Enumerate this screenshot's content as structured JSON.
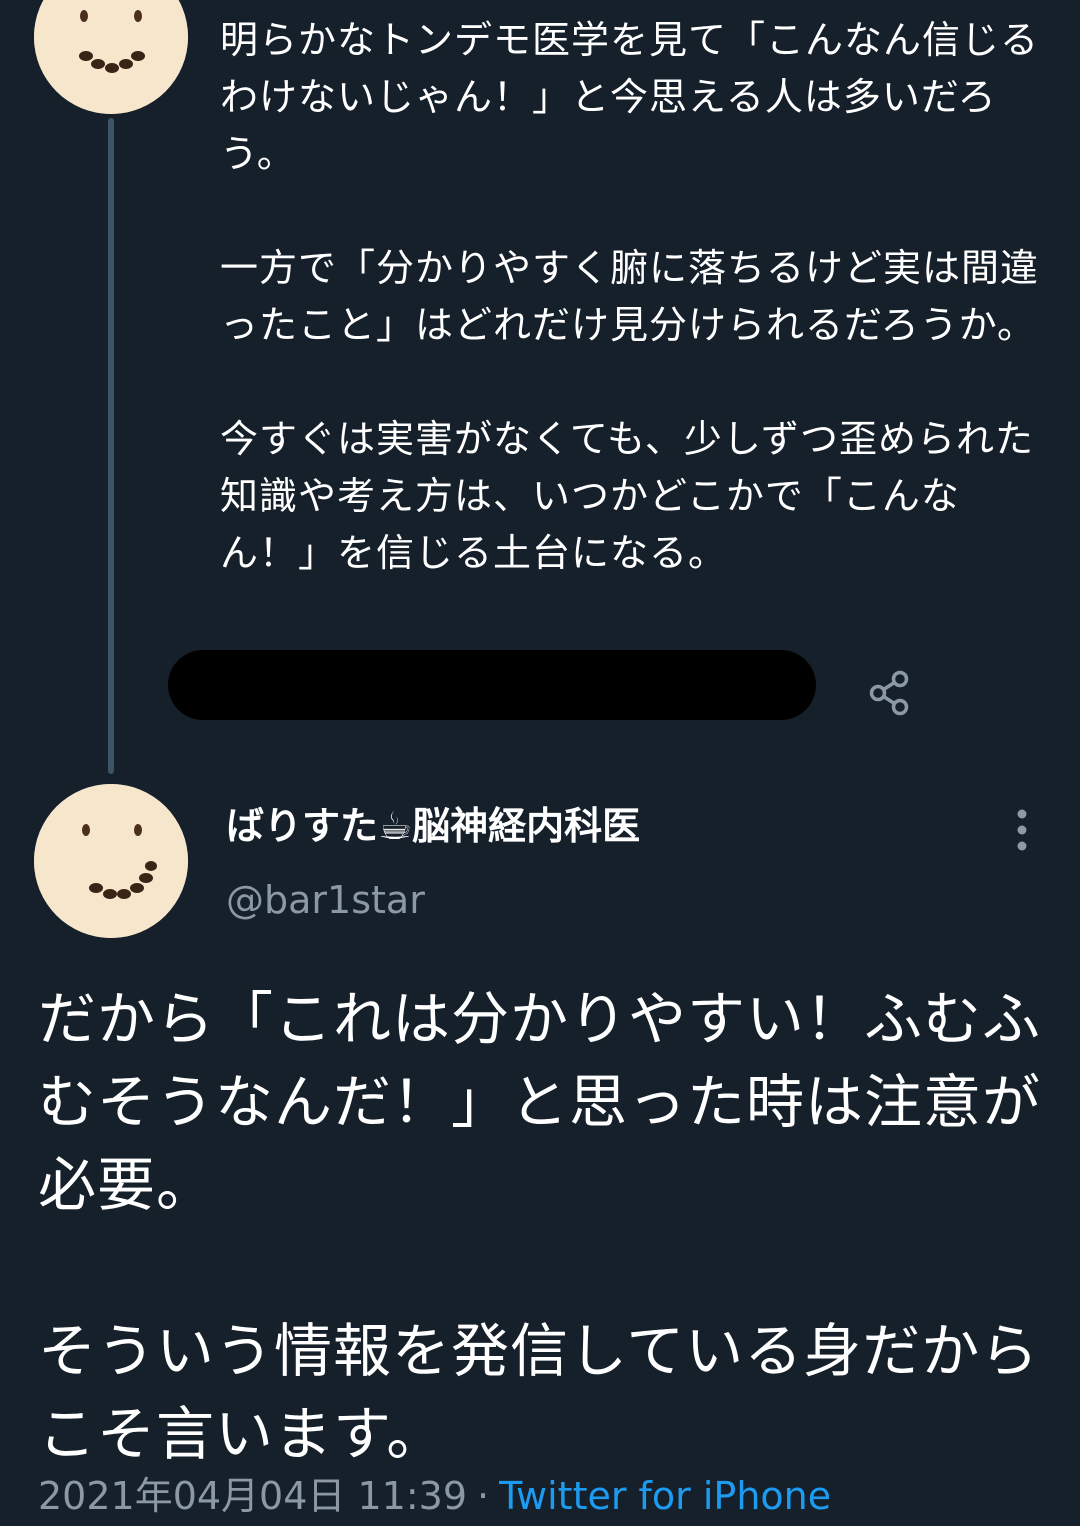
{
  "previous_tweet": {
    "paragraphs": [
      "明らかなトンデモ医学を見て「こんなん信じるわけないじゃん！」と今思える人は多いだろう。",
      "一方で「分かりやすく腑に落ちるけど実は間違ったこと」はどれだけ見分けられるだろうか。",
      "今すぐは実害がなくても、少しずつ歪められた知識や考え方は、いつかどこかで「こんなん！」を信じる土台になる。"
    ],
    "share_icon": "share-icon"
  },
  "author": {
    "name": "ばりすた☕脳神経内科医",
    "handle": "@bar1star",
    "more_icon": "more-vertical-icon"
  },
  "tweet": {
    "paragraphs": [
      "だから「これは分かりやすい！ふむふむそうなんだ！」と思った時は注意が必要。",
      "そういう情報を発信している身だからこそ言います。"
    ],
    "timestamp": "2021年04月04日 11:39",
    "separator": "·",
    "source": "Twitter for iPhone"
  },
  "colors": {
    "background": "#15202b",
    "text": "#ffffff",
    "secondary_text": "#8b98a5",
    "link": "#1d9bf0",
    "thread_line": "#3d5466",
    "avatar": "#f6e6cc"
  }
}
